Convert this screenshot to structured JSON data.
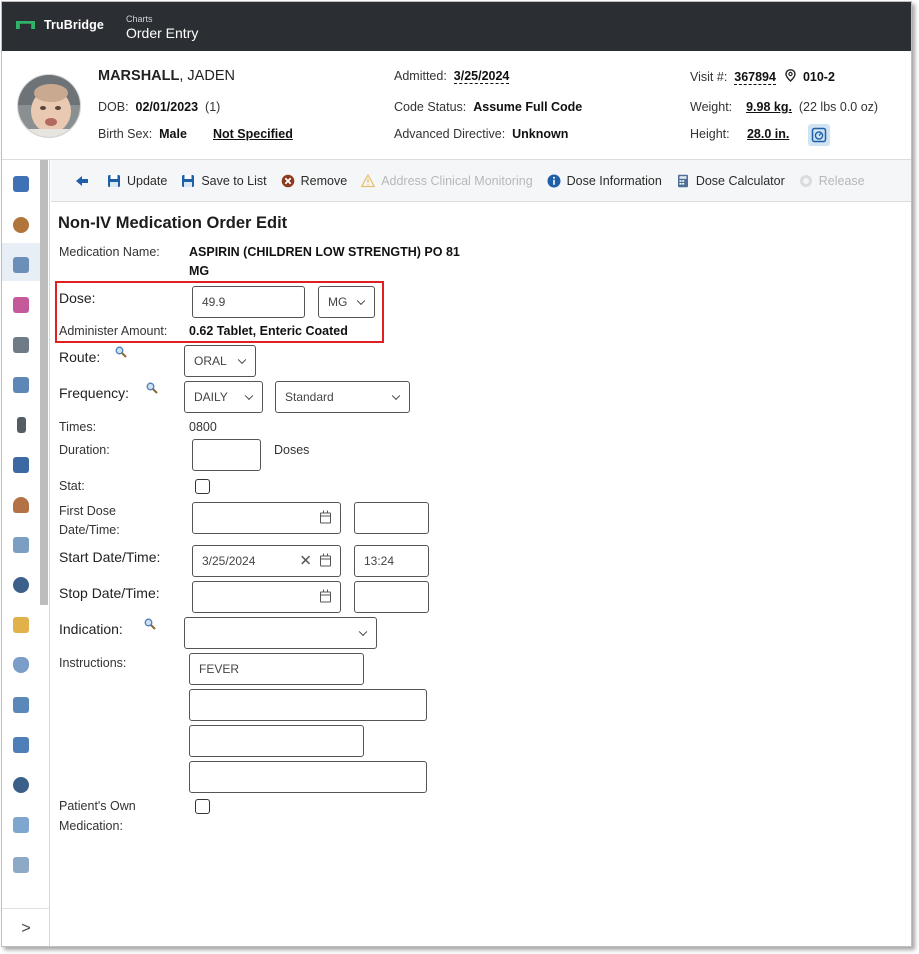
{
  "app": {
    "brand": "TruBridge",
    "breadcrumb_parent": "Charts",
    "breadcrumb_current": "Order Entry"
  },
  "patient": {
    "last_name": "MARSHALL",
    "first_name": "JADEN",
    "dob_label": "DOB:",
    "dob": "02/01/2023",
    "age": "(1)",
    "birth_sex_label": "Birth Sex:",
    "birth_sex": "Male",
    "gender_identity": "Not Specified",
    "admitted_label": "Admitted:",
    "admitted": "3/25/2024",
    "code_status_label": "Code Status:",
    "code_status": "Assume Full Code",
    "adv_directive_label": "Advanced Directive:",
    "adv_directive": "Unknown",
    "visit_label": "Visit #:",
    "visit": "367894",
    "room": "010-2",
    "weight_label": "Weight:",
    "weight": "9.98 kg.",
    "weight_alt": "(22 lbs 0.0 oz)",
    "height_label": "Height:",
    "height": "28.0 in."
  },
  "toolbar": {
    "update": "Update",
    "save_to_list": "Save to List",
    "remove": "Remove",
    "address_monitoring": "Address Clinical Monitoring",
    "dose_information": "Dose Information",
    "dose_calculator": "Dose Calculator",
    "release": "Release"
  },
  "form": {
    "title": "Non-IV Medication Order Edit",
    "medication_name_label": "Medication Name:",
    "medication_name_line1": "ASPIRIN (CHILDREN LOW STRENGTH) PO 81",
    "medication_name_line2": "MG",
    "dose_label": "Dose:",
    "dose_value": "49.9",
    "dose_unit": "MG",
    "administer_label": "Administer Amount:",
    "administer_value": "0.62 Tablet, Enteric Coated",
    "route_label": "Route:",
    "route_value": "ORAL",
    "frequency_label": "Frequency:",
    "frequency_value": "DAILY",
    "frequency_type": "Standard",
    "times_label": "Times:",
    "times_value": "0800",
    "duration_label": "Duration:",
    "duration_unit": "Doses",
    "stat_label": "Stat:",
    "first_dose_label_1": "First Dose",
    "first_dose_label_2": "Date/Time:",
    "start_label": "Start Date/Time:",
    "start_date": "3/25/2024",
    "start_time": "13:24",
    "stop_label": "Stop Date/Time:",
    "indication_label": "Indication:",
    "instructions_label": "Instructions:",
    "instructions_1": "FEVER",
    "patients_own_label_1": "Patient's Own",
    "patients_own_label_2": "Medication:"
  },
  "colors": {
    "topbar": "#2b2f33",
    "brand_green": "#2fb36b",
    "highlight_red": "#e02020",
    "info_blue": "#1e5fa8"
  },
  "expand_label": ">"
}
